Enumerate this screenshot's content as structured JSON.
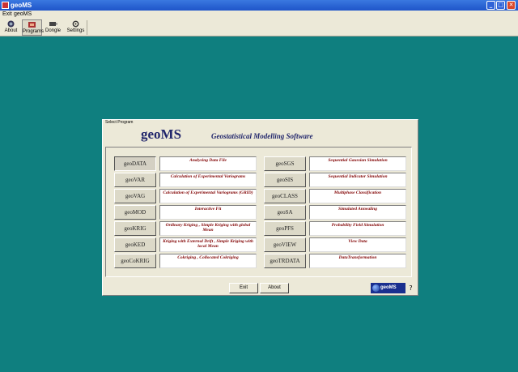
{
  "window": {
    "title": "geoMS"
  },
  "menu": {
    "items": [
      "Exit",
      "geoMS"
    ]
  },
  "toolbar": {
    "buttons": [
      {
        "label": "About",
        "icon": "about-icon"
      },
      {
        "label": "Programs",
        "icon": "programs-icon"
      },
      {
        "label": "Dongle",
        "icon": "dongle-icon"
      },
      {
        "label": "Settings",
        "icon": "settings-icon"
      }
    ]
  },
  "dialog": {
    "caption": "Select Program",
    "brand": "geoMS",
    "subtitle": "Geostatistical  Modelling Software",
    "left": [
      {
        "name": "geoDATA",
        "desc": "Analysing Data File"
      },
      {
        "name": "geoVAR",
        "desc": "Calculation of Experimental Variograms"
      },
      {
        "name": "geoVAG",
        "desc": "Calculation of Experimental Variograms (GRID)"
      },
      {
        "name": "geoMOD",
        "desc": "Interactive Fit"
      },
      {
        "name": "geoKRIG",
        "desc": "Ordinary Kriging , Simple Kriging with global Mean"
      },
      {
        "name": "geoKED",
        "desc": "Kriging with External Drift , Simple Kriging with local Mean"
      },
      {
        "name": "geoCoKRIG",
        "desc": "Cokriging , Collocated Cokriging"
      }
    ],
    "right": [
      {
        "name": "geoSGS",
        "desc": "Sequential Gaussian Simulation"
      },
      {
        "name": "geoSIS",
        "desc": "Sequential Indicator Simulation"
      },
      {
        "name": "geoCLASS",
        "desc": "Multiphase Classification"
      },
      {
        "name": "geoSA",
        "desc": "Simulated Annealing"
      },
      {
        "name": "geoPFS",
        "desc": "Probability Field Simulation"
      },
      {
        "name": "geoVIEW",
        "desc": "View Data"
      },
      {
        "name": "geoTRDATA",
        "desc": "DataTransformation"
      }
    ],
    "exit_label": "Exit",
    "about_label": "About",
    "logo_text": "geoMS"
  }
}
